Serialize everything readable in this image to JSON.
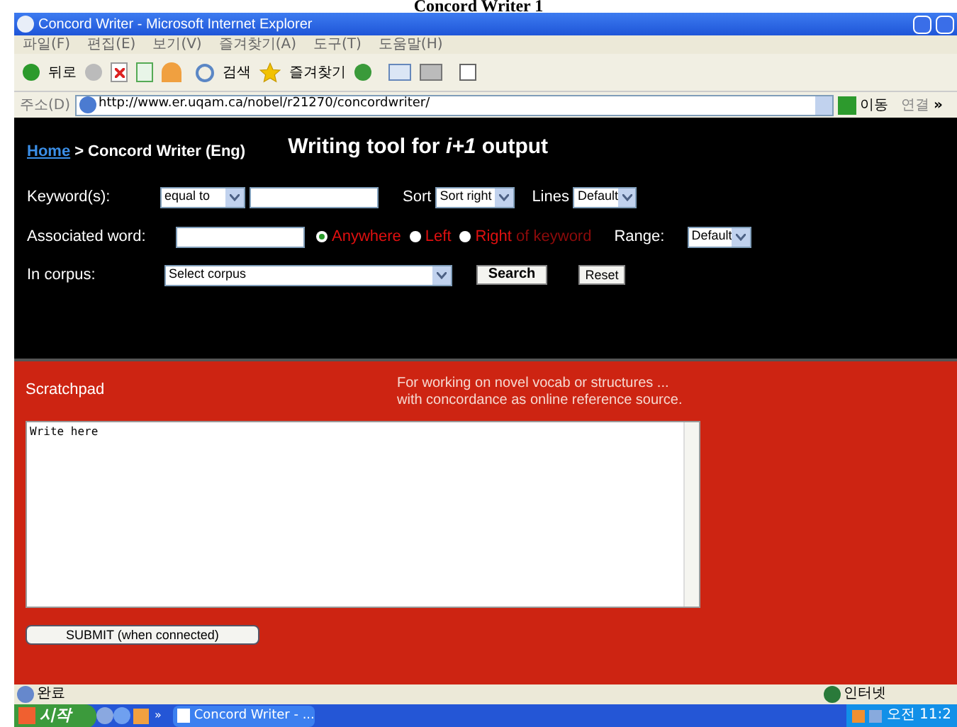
{
  "caption": "Concord Writer 1",
  "window": {
    "title": "Concord Writer - Microsoft Internet Explorer"
  },
  "menu": [
    "파일(F)",
    "편집(E)",
    "보기(V)",
    "즐겨찾기(A)",
    "도구(T)",
    "도움말(H)"
  ],
  "toolbar": {
    "back": "뒤로",
    "search": "검색",
    "favorites": "즐겨찾기"
  },
  "address": {
    "label": "주소(D)",
    "url": "http://www.er.uqam.ca/nobel/r21270/concordwriter/",
    "go": "이동",
    "links": "연결",
    "more": "»"
  },
  "breadcrumb": {
    "link": "Home",
    "rest": "> Concord Writer (Eng)"
  },
  "heading": "Writing tool for *i+1* output",
  "keyword": {
    "label": "Keyword(s):",
    "match": "equal to",
    "sort_label": "Sort",
    "sort": "Sort right",
    "lines_label": "Lines",
    "lines": "Default"
  },
  "associated": {
    "label": "Associated word:",
    "positions": [
      {
        "label": "Anywhere",
        "selected": true
      },
      {
        "label": "Left",
        "selected": false
      },
      {
        "label": "**Right** of keyword",
        "selected": false
      }
    ],
    "range_label": "Range:",
    "range": "Default"
  },
  "corpus": {
    "label": "In corpus:",
    "select": "Select corpus",
    "search": "Search",
    "reset": "Reset"
  },
  "scratchpad": {
    "title": "Scratchpad",
    "note": [
      "For working on novel vocab or structures ...",
      "with concordance as online reference source."
    ],
    "text": "Write here",
    "submit": "SUBMIT (when connected)"
  },
  "status_bar": {
    "status": "완료",
    "zone": "인터넷"
  },
  "taskbar": {
    "start": "시작",
    "more": "»",
    "task": "Concord Writer - ...",
    "clock": "오전 11:2"
  }
}
